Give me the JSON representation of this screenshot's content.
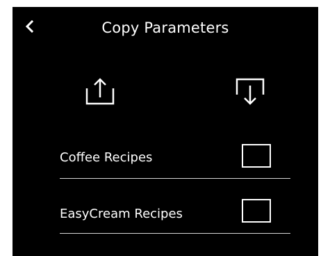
{
  "header": {
    "title": "Copy Parameters",
    "back_icon": "chevron-left-icon"
  },
  "actions": {
    "export_icon": "upload-export-icon",
    "import_icon": "download-import-icon"
  },
  "options": [
    {
      "label": "Coffee Recipes",
      "checked": false
    },
    {
      "label": "EasyCream Recipes",
      "checked": false
    }
  ],
  "colors": {
    "background": "#000000",
    "foreground": "#ffffff",
    "divider": "#d8d8d8"
  }
}
